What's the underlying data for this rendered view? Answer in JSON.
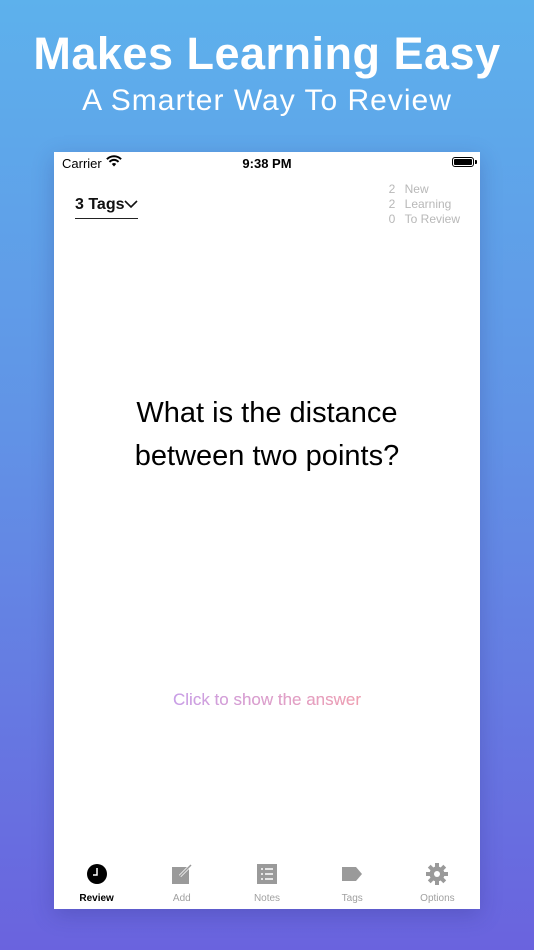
{
  "promo": {
    "headline": "Makes Learning Easy",
    "subheadline": "A Smarter Way To Review"
  },
  "status_bar": {
    "carrier": "Carrier",
    "time": "9:38 PM"
  },
  "header": {
    "tags_selector_label": "3 Tags"
  },
  "stats": [
    {
      "count": "2",
      "label": "New"
    },
    {
      "count": "2",
      "label": "Learning"
    },
    {
      "count": "0",
      "label": "To Review"
    }
  ],
  "card": {
    "question": "What is the distance between two points?",
    "show_answer_label": "Click to show the answer"
  },
  "tabbar": {
    "items": [
      {
        "label": "Review",
        "icon": "clock-icon",
        "active": true
      },
      {
        "label": "Add",
        "icon": "edit-icon",
        "active": false
      },
      {
        "label": "Notes",
        "icon": "list-icon",
        "active": false
      },
      {
        "label": "Tags",
        "icon": "tag-icon",
        "active": false
      },
      {
        "label": "Options",
        "icon": "gear-icon",
        "active": false
      }
    ]
  },
  "colors": {
    "background_top": "#5db1ec",
    "background_bottom": "#6a63de",
    "answer_gradient_start": "#c8a0e8",
    "answer_gradient_end": "#f0a0b0",
    "inactive_tab": "#a0a0a0"
  }
}
